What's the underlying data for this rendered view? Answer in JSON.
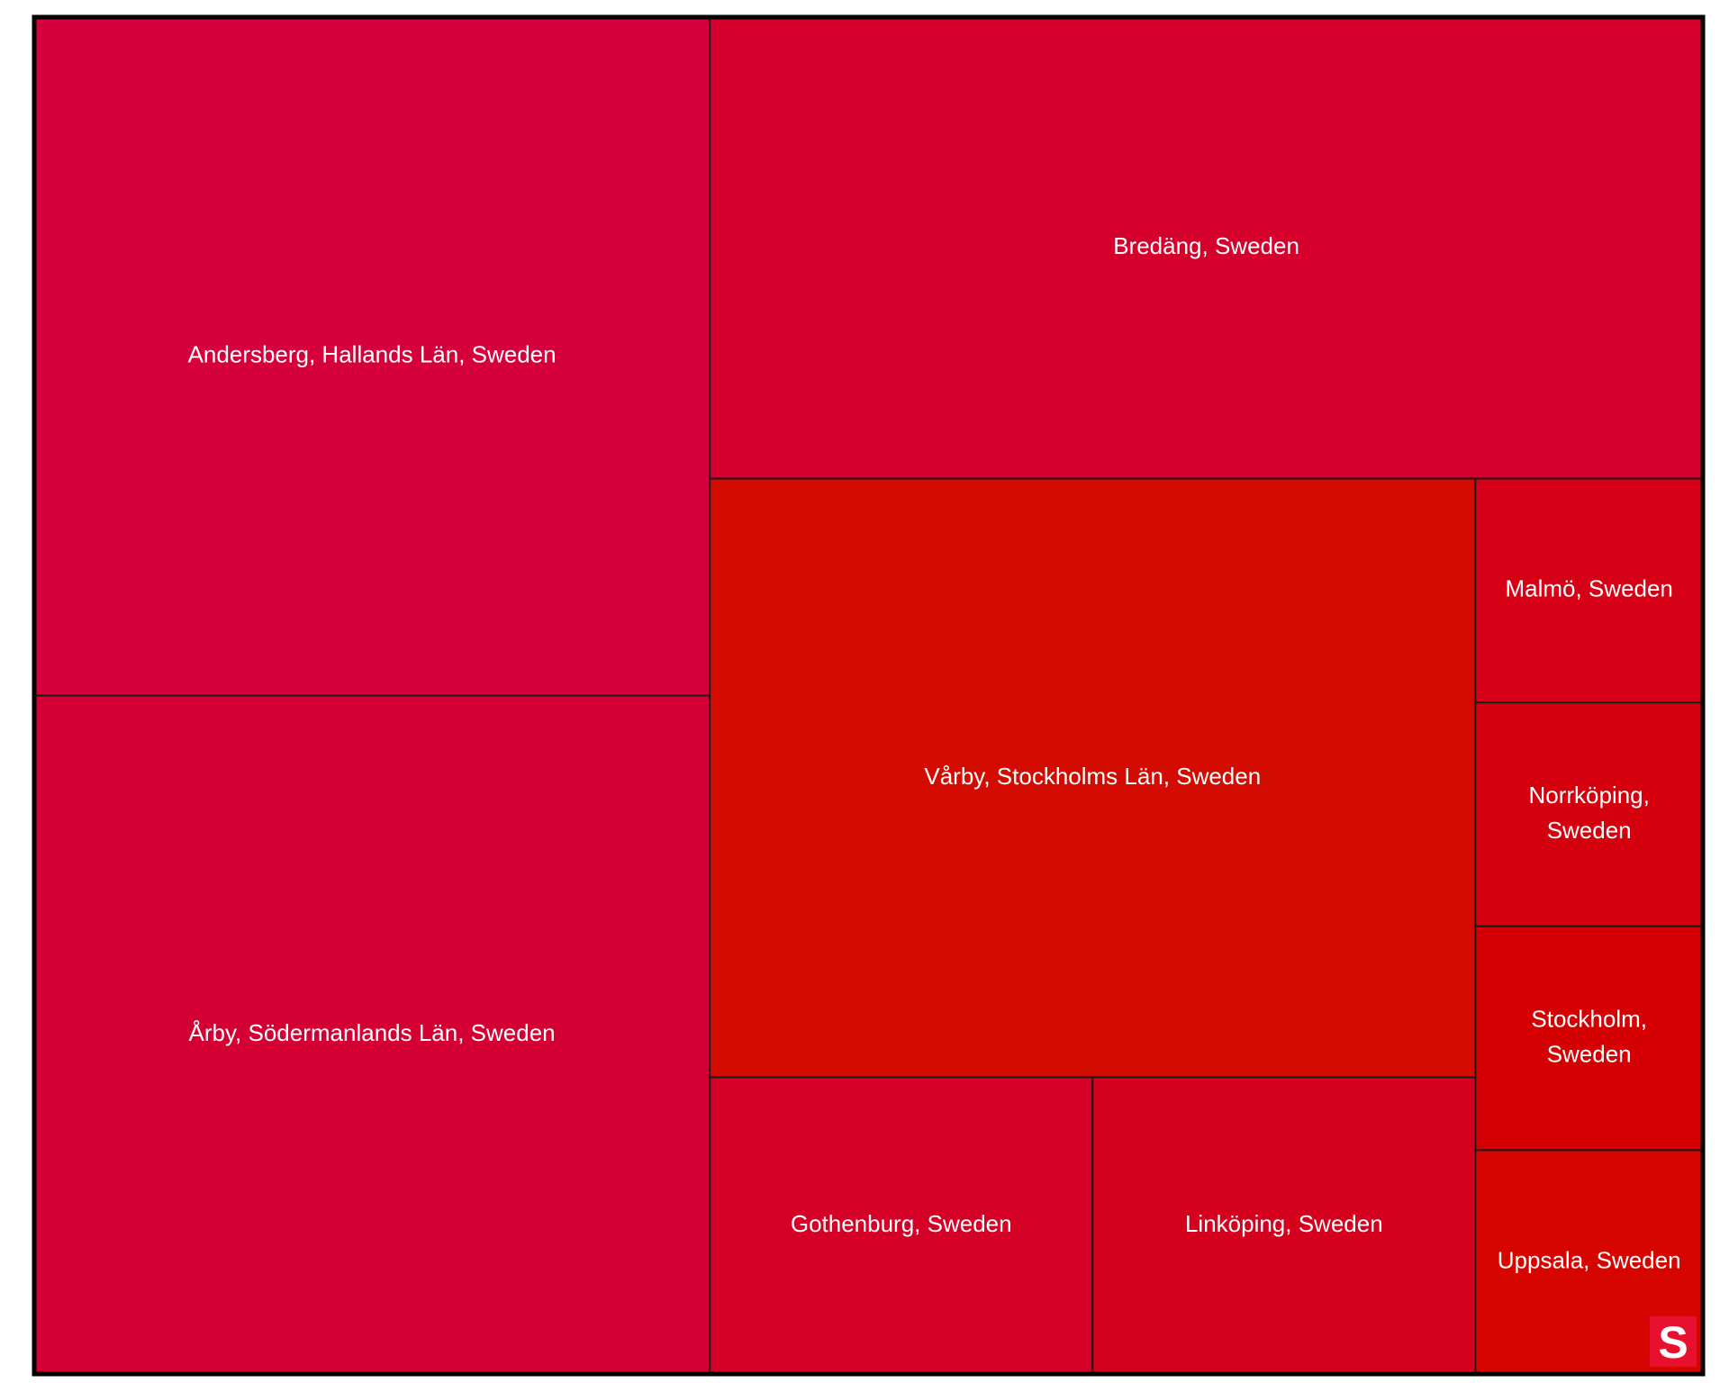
{
  "chart_data": {
    "type": "treemap",
    "tiles": [
      {
        "label": "Andersberg, Hallands Län, Sweden",
        "value": 117,
        "color": "#d5003c"
      },
      {
        "label": "Årby, Södermanlands Län, Sweden",
        "value": 117,
        "color": "#d40034"
      },
      {
        "label": "Bredäng, Sweden",
        "value": 117,
        "color": "#d6002d"
      },
      {
        "label": "Vårby, Stockholms Län, Sweden",
        "value": 117,
        "color": "#d40b00"
      },
      {
        "label": "Gothenburg, Sweden",
        "value": 29,
        "color": "#d50026"
      },
      {
        "label": "Linköping, Sweden",
        "value": 29,
        "color": "#d5001e"
      },
      {
        "label": "Malmö, Sweden",
        "value": 13,
        "color": "#d60016"
      },
      {
        "label": "Norrköping, Sweden",
        "value": 13,
        "color": "#d5000e"
      },
      {
        "label": "Stockholm, Sweden",
        "value": 13,
        "color": "#d50004"
      },
      {
        "label": "Uppsala, Sweden",
        "value": 13,
        "color": "#d60500"
      }
    ]
  },
  "logo": {
    "text": "S",
    "color": "#e8102e"
  }
}
